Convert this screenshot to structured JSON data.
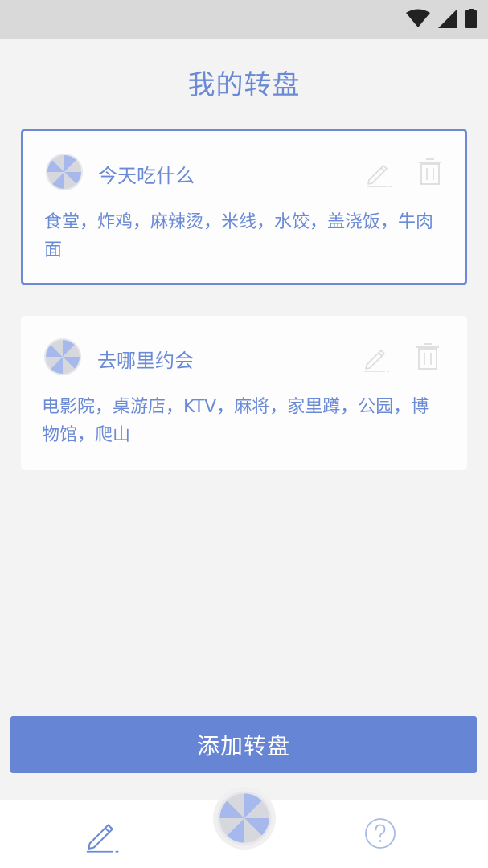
{
  "header": {
    "title": "我的转盘"
  },
  "cards": [
    {
      "name": "今天吃什么",
      "items": "食堂，炸鸡，麻辣烫，米线，水饺，盖浇饭，牛肉面",
      "selected": true
    },
    {
      "name": "去哪里约会",
      "items": "电影院，桌游店，KTV，麻将，家里蹲，公园，博物馆，爬山",
      "selected": false
    }
  ],
  "add_button": {
    "label": "添加转盘"
  },
  "icons": {
    "status": [
      "wifi-icon",
      "signal-icon",
      "battery-icon"
    ],
    "card_actions": [
      "pencil-icon",
      "trash-icon"
    ],
    "wheel": "wheel-icon",
    "nav": [
      "pencil-icon",
      "wheel-icon",
      "help-icon"
    ]
  },
  "colors": {
    "accent": "#6a8ad6",
    "button": "#6685d4",
    "icon_disabled": "#dcdcdc",
    "background": "#f3f3f4",
    "status_bar": "#d9d9d9"
  }
}
